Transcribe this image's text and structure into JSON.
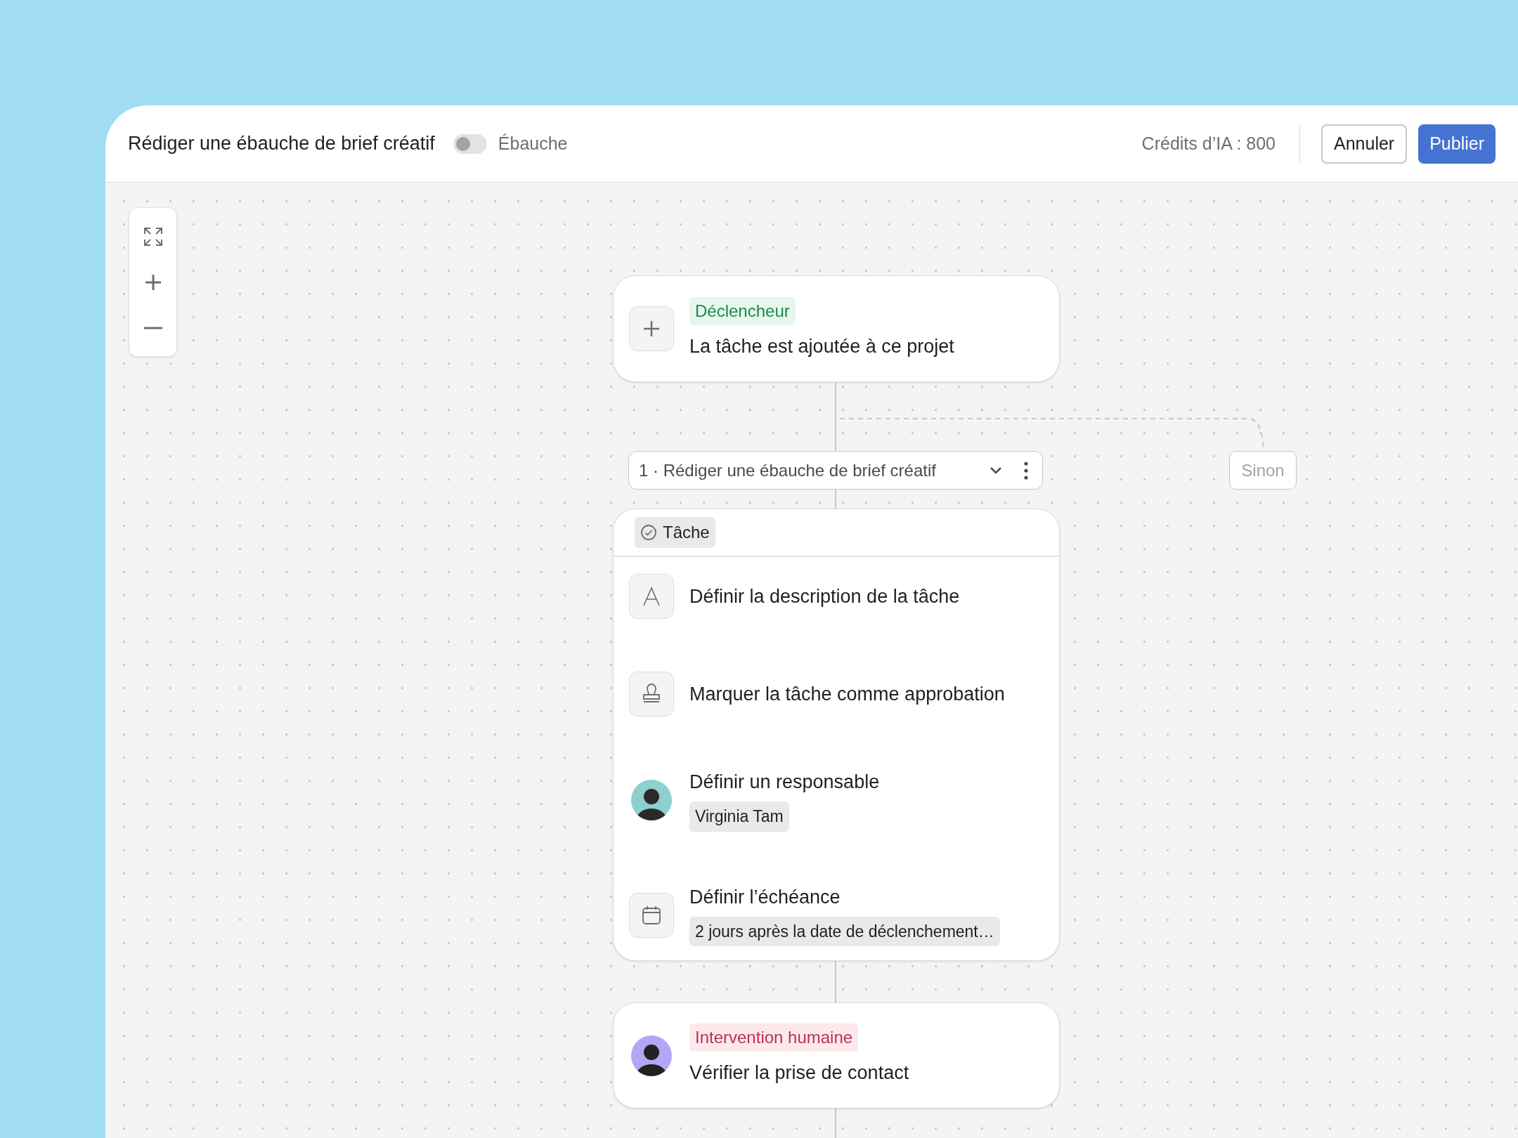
{
  "header": {
    "title": "Rédiger une ébauche de brief créatif",
    "status_toggle": {
      "on": false,
      "label": "Ébauche"
    },
    "credits": "Crédits d’IA : 800",
    "buttons": [
      {
        "label": "Annuler",
        "kind": "secondary"
      },
      {
        "label": "Publier",
        "kind": "primary"
      }
    ]
  },
  "trigger": {
    "tag": "Déclencheur",
    "title": "La tâche est ajoutée à ce projet"
  },
  "step": {
    "label": "1 · Rédiger une ébauche de brief créatif"
  },
  "else_branch": {
    "label": "Sinon"
  },
  "task_card": {
    "tag": "Tâche",
    "actions": [
      {
        "kind": "text",
        "label": "Définir la description de la tâche"
      },
      {
        "kind": "approval",
        "label": "Marquer la tâche comme approbation"
      },
      {
        "kind": "assignee",
        "label": "Définir un responsable",
        "value": "Virginia Tam"
      },
      {
        "kind": "due_date",
        "label": "Définir l’échéance",
        "value": "2 jours après la date de déclenchement…"
      }
    ]
  },
  "human_step": {
    "tag": "Intervention humaine",
    "title": "Vérifier la prise de contact"
  }
}
